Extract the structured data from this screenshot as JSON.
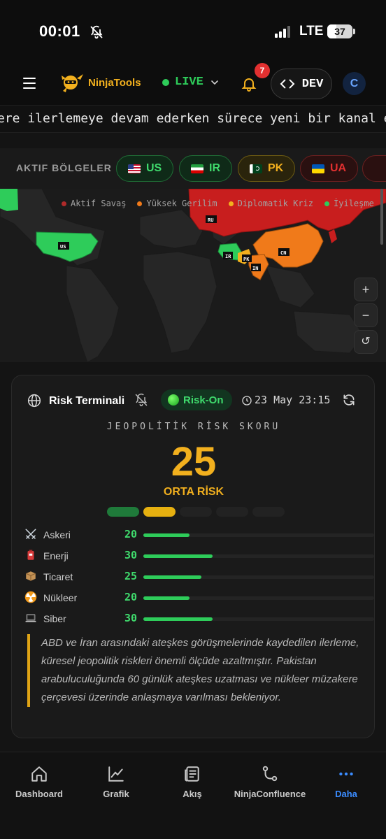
{
  "status_bar": {
    "time": "00:01",
    "network": "LTE",
    "battery": "37",
    "battery_level": 0.37
  },
  "header": {
    "logo_text": "NinjaTools",
    "live_label": "LIVE",
    "notification_count": "7",
    "dev_label": "DEV",
    "avatar_initial": "C"
  },
  "ticker": {
    "text": "ere ilerlemeye devam ederken sürece yeni bir kanal e"
  },
  "regions": {
    "title": "AKTIF BÖLGELER",
    "chips": [
      {
        "code": "US",
        "color": "#2ecc5a"
      },
      {
        "code": "IR",
        "color": "#2ecc5a"
      },
      {
        "code": "PK",
        "color": "#f2b01e"
      },
      {
        "code": "UA",
        "color": "#e23030"
      }
    ]
  },
  "map": {
    "legend": [
      {
        "label": "Aktif Savaş",
        "color": "#b02a2a"
      },
      {
        "label": "Yüksek Gerilim",
        "color": "#f07a1a"
      },
      {
        "label": "Diplomatik Kriz",
        "color": "#f2b01e"
      },
      {
        "label": "İyileşme",
        "color": "#2ecc5a"
      }
    ],
    "country_labels": [
      "US",
      "RU",
      "IR",
      "PK",
      "IN",
      "CN"
    ],
    "zoom_in": "+",
    "zoom_out": "−",
    "reset": "↺"
  },
  "risk_card": {
    "title": "Risk Terminali",
    "status": "Risk-On",
    "timestamp": "23 May 23:15",
    "score_label": "JEOPOLİTİK RİSK SKORU",
    "score": "25",
    "level": "ORTA RİSK",
    "scale_fill": [
      {
        "color": "#1f7a3a"
      },
      {
        "color": "#e6b010"
      },
      {
        "color": "#222222"
      },
      {
        "color": "#222222"
      },
      {
        "color": "#222222"
      }
    ],
    "metrics": [
      {
        "label": "Askeri",
        "value": "20",
        "pct": 20,
        "icon": "swords-icon"
      },
      {
        "label": "Enerji",
        "value": "30",
        "pct": 30,
        "icon": "fuel-icon"
      },
      {
        "label": "Ticaret",
        "value": "25",
        "pct": 25,
        "icon": "package-icon"
      },
      {
        "label": "Nükleer",
        "value": "20",
        "pct": 20,
        "icon": "radiation-icon"
      },
      {
        "label": "Siber",
        "value": "30",
        "pct": 30,
        "icon": "laptop-icon"
      }
    ],
    "summary": "ABD ve İran arasındaki ateşkes görüşmelerinde kaydedilen ilerleme, küresel jeopolitik riskleri önemli ölçüde azaltmıştır. Pakistan arabuluculuğunda 60 günlük ateşkes uzatması ve nükleer müzakere çerçevesi üzerinde anlaşmaya varılması bekleniyor."
  },
  "bottom_nav": [
    {
      "label": "Dashboard",
      "icon": "home-icon"
    },
    {
      "label": "Grafik",
      "icon": "chart-icon"
    },
    {
      "label": "Akış",
      "icon": "feed-icon"
    },
    {
      "label": "NinjaConfluence",
      "icon": "branch-icon"
    },
    {
      "label": "Daha",
      "icon": "more-icon",
      "active": true
    }
  ],
  "colors": {
    "accent": "#f2b01e",
    "green": "#2ecc5a",
    "blue": "#3b8cff",
    "background": "#141414"
  }
}
